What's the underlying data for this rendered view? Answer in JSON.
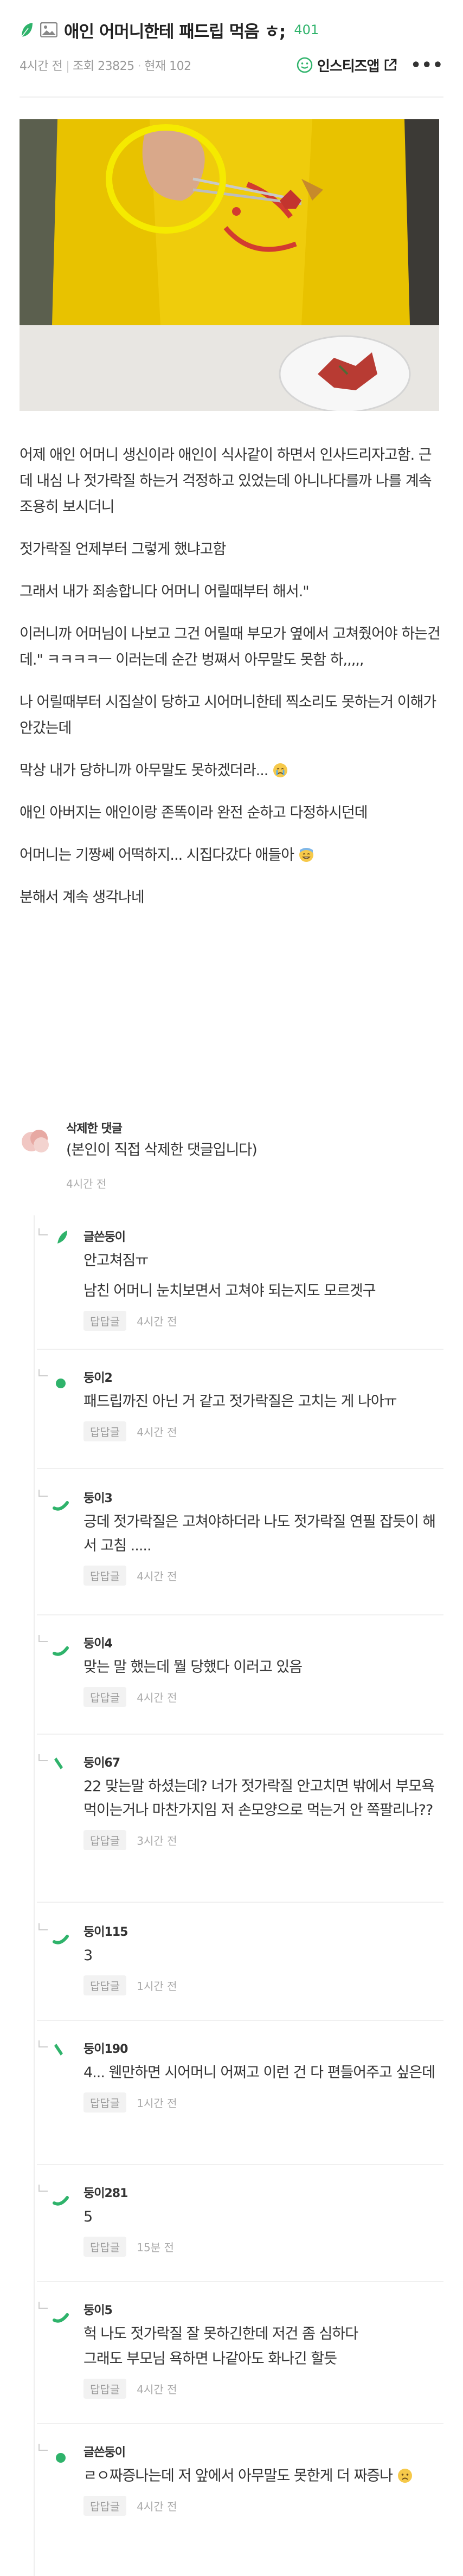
{
  "post": {
    "title": "애인 어머니한테 패드립 먹음 ㅎ;",
    "comment_count": "401",
    "time": "4시간 전",
    "views": "조회 23825",
    "recommend": "현재 102",
    "share_label": "인스티즈앱",
    "more": "•••"
  },
  "body": [
    "어제 애인 어머니 생신이라 애인이 식사같이 하면서 인사드리자고함. 근데 내심 나 젓가락질 하는거 걱정하고 있었는데 아니나다를까 나를 계속 조용히 보시더니",
    "젓가락질 언제부터 그렇게 했냐고함",
    "그래서 내가 죄송합니다 어머니 어릴때부터 해서.\"",
    "이러니까 어머님이 나보고 그건 어릴때 부모가 옆에서 고쳐줬어야 하는건데.\" ㅋㅋㅋㅋㅡ 이러는데 순간 벙쪄서 아무말도 못함 하,,,,,",
    "나 어릴때부터 시집살이 당하고 시어머니한테 찍소리도 못하는거 이해가 안갔는데",
    "막상 내가 당하니까 아무말도 못하겠더라...",
    "애인 아버지는 애인이랑 존똑이라 완전 순하고 다정하시던데",
    "어머니는 기짱쎄 어떡하지... 시집다갔다 애들아",
    "분해서 계속 생각나네"
  ],
  "comments": {
    "deleted": {
      "name": "삭제한 댓글",
      "text": "(본인이 직접 삭제한 댓글입니다)",
      "time": "4시간 전"
    },
    "reply_label": "답답글",
    "replies": [
      {
        "name": "글쓴둥이",
        "lines": [
          "안고쳐짐ㅠ",
          "남친 어머니 눈치보면서 고쳐야 되는지도 모르겟구"
        ],
        "time": "4시간 전"
      },
      {
        "name": "둥이2",
        "lines": [
          "패드립까진 아닌 거 같고 젓가락질은 고치는 게 나아ㅠ"
        ],
        "time": "4시간 전"
      },
      {
        "name": "둥이3",
        "lines": [
          "긍데 젓가락질은 고쳐야하더라 나도 젓가락질 연필 잡듯이 해서 고침 ....."
        ],
        "time": "4시간 전"
      },
      {
        "name": "둥이4",
        "lines": [
          "맞는 말 했는데 뭘 당했다 이러고 있음"
        ],
        "time": "4시간 전"
      },
      {
        "name": "둥이67",
        "lines": [
          "22 맞는말 하셨는데? 너가 젓가락질 안고치면 밖에서 부모욕 먹이는거나 마찬가지임 저 손모양으로 먹는거 안 쪽팔리나??"
        ],
        "time": "3시간 전"
      },
      {
        "name": "둥이115",
        "lines": [
          "3"
        ],
        "time": "1시간 전"
      },
      {
        "name": "둥이190",
        "lines": [
          "4... 웬만하면 시어머니 어쩌고 이런 건 다 편들어주고 싶은데"
        ],
        "time": "1시간 전"
      },
      {
        "name": "둥이281",
        "lines": [
          "5"
        ],
        "time": "15분 전"
      },
      {
        "name": "둥이5",
        "lines": [
          "헉 나도 젓가락질 잘 못하긴한데 저건 좀 심하다",
          "그래도 부모님 욕하면 나같아도 화나긴 할듯"
        ],
        "time": "4시간 전"
      },
      {
        "name": "글쓴둥이",
        "lines": [
          "ㄹㅇ짜증나는데 저 앞에서 아무말도 못한게 더 짜증나"
        ],
        "time": "4시간 전"
      }
    ]
  },
  "colors": {
    "accent": "#2fb36b",
    "shirt": "#e8c200",
    "circle": "#f2e600"
  }
}
